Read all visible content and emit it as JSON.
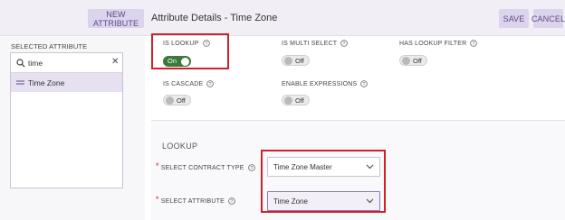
{
  "toolbar": {
    "new_attribute": "NEW ATTRIBUTE",
    "title": "Attribute Details - Time Zone",
    "save": "SAVE",
    "cancel": "CANCEL"
  },
  "sidebar": {
    "label": "SELECTED ATTRIBUTE",
    "search_value": "time",
    "items": [
      {
        "label": "Time Zone"
      }
    ]
  },
  "flags": {
    "is_lookup": {
      "label": "IS LOOKUP",
      "state": "On"
    },
    "is_multi_select": {
      "label": "IS MULTI SELECT",
      "state": "Off"
    },
    "has_lookup_filter": {
      "label": "HAS LOOKUP FILTER",
      "state": "Off"
    },
    "is_cascade": {
      "label": "IS CASCADE",
      "state": "Off"
    },
    "enable_expressions": {
      "label": "ENABLE EXPRESSIONS",
      "state": "Off"
    }
  },
  "lookup": {
    "title": "LOOKUP",
    "contract_type": {
      "label": "SELECT CONTRACT TYPE",
      "value": "Time Zone Master"
    },
    "attribute": {
      "label": "SELECT ATTRIBUTE",
      "value": "Time Zone"
    }
  },
  "colors": {
    "accent": "#5b4a85",
    "toggle_on": "#3b7a3b",
    "highlight": "#d21f2a"
  }
}
